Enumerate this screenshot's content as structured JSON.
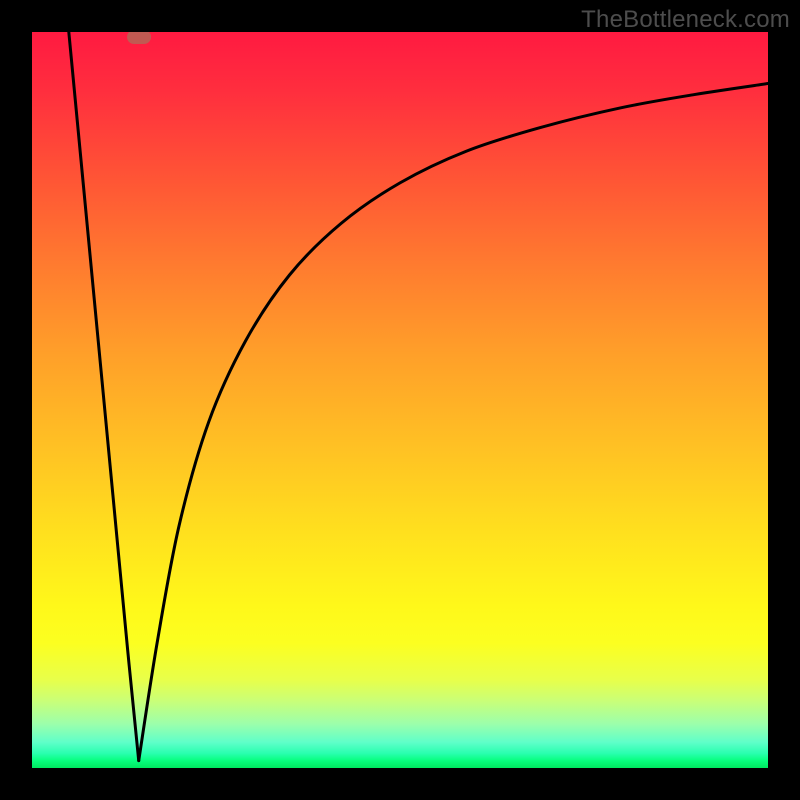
{
  "watermark": "TheBottleneck.com",
  "marker": {
    "x_frac": 0.145,
    "y_frac": 0.993
  },
  "chart_data": {
    "type": "line",
    "title": "",
    "xlabel": "",
    "ylabel": "",
    "xlim": [
      0,
      1
    ],
    "ylim": [
      0,
      1
    ],
    "note": "Axes unlabeled; values are fractions of plot width/height (origin bottom-left). Two curves sharing a minimum near x≈0.145: a steep near-linear left branch and an upward saturating curve to the right.",
    "series": [
      {
        "name": "left-branch",
        "x": [
          0.05,
          0.07,
          0.09,
          0.11,
          0.13,
          0.145
        ],
        "y": [
          1.0,
          0.79,
          0.58,
          0.37,
          0.16,
          0.01
        ]
      },
      {
        "name": "right-curve",
        "x": [
          0.145,
          0.17,
          0.2,
          0.24,
          0.29,
          0.35,
          0.42,
          0.5,
          0.59,
          0.69,
          0.8,
          0.9,
          1.0
        ],
        "y": [
          0.01,
          0.17,
          0.33,
          0.47,
          0.58,
          0.67,
          0.74,
          0.795,
          0.838,
          0.87,
          0.897,
          0.915,
          0.93
        ]
      }
    ],
    "gradient_colors_top_to_bottom": [
      "#ff1a41",
      "#ff7c2f",
      "#ffe01e",
      "#fcff20",
      "#5fffc9",
      "#00e860"
    ]
  }
}
